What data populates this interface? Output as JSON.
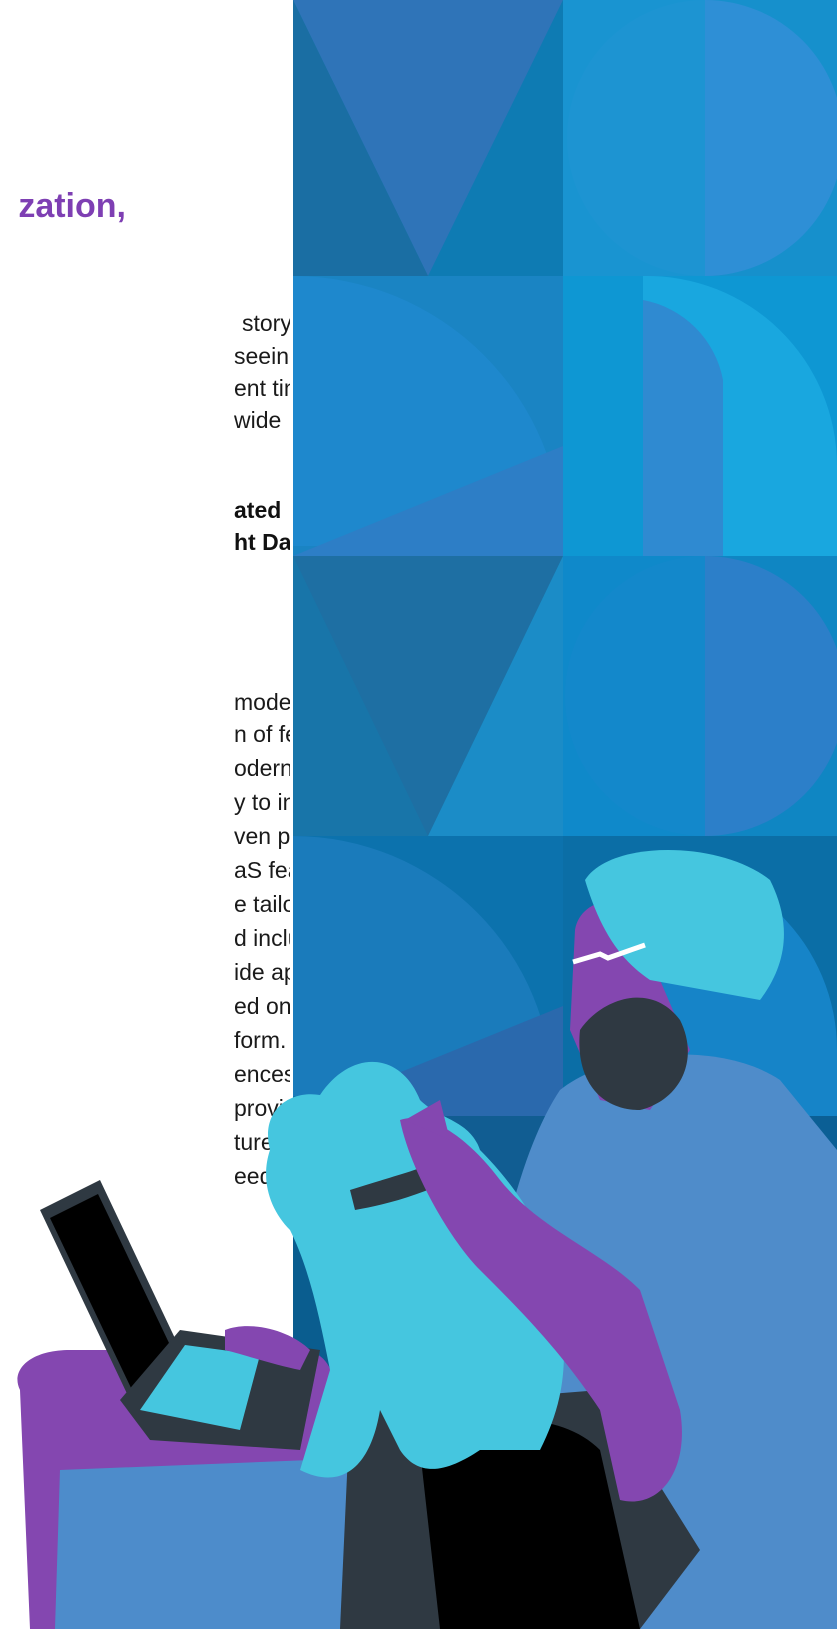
{
  "heading": {
    "text": "zation,"
  },
  "intro": {
    "lines": [
      "story.",
      "seeing",
      "ent time",
      "wide"
    ]
  },
  "callout": {
    "lines": [
      "ated",
      "ht DaaS"
    ]
  },
  "body": {
    "lines": [
      "model that allows",
      "n of features and",
      "odern DaaS models",
      "y to increase,",
      "ven pause solution",
      "aS features and",
      "e tailored to fit your",
      "d include devices",
      "ide appeal, like",
      "ed on the Intel®",
      "form. They offer",
      "ences employees",
      "providing the",
      "ture-proofing your",
      "eeds."
    ]
  },
  "colors": {
    "accent_purple": "#7e3fb3",
    "teal": "#45c6df",
    "blue_panel": "#1677b4",
    "dark": "#2e3a43"
  }
}
